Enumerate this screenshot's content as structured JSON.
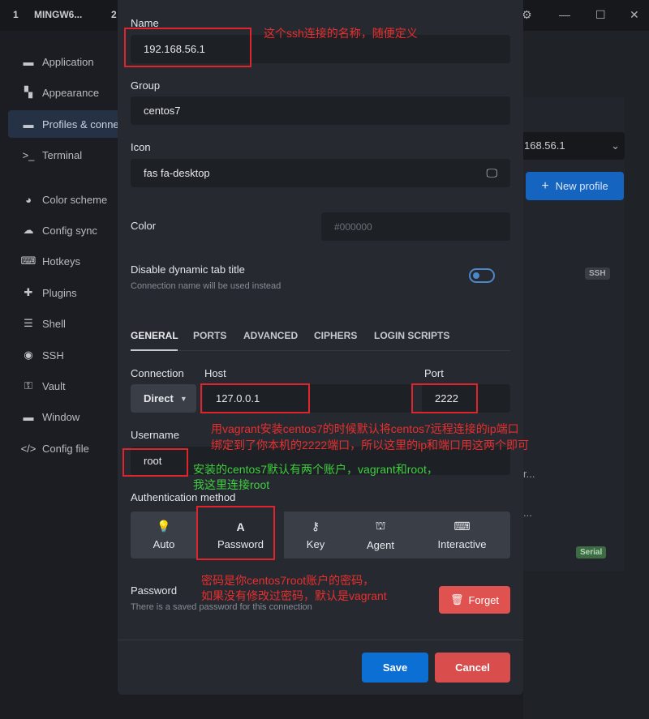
{
  "window": {
    "tab_number": "1",
    "tab_title": "MINGW6...",
    "tab2_number": "2",
    "icons": [
      "gear-icon",
      "minimize-icon",
      "maximize-icon",
      "close-icon"
    ]
  },
  "sidebar": {
    "items": [
      {
        "label": "Application",
        "icon": "window-icon"
      },
      {
        "label": "Appearance",
        "icon": "paint-icon"
      },
      {
        "label": "Profiles & conne",
        "icon": "window-icon",
        "active": true
      },
      {
        "label": "Terminal",
        "icon": "terminal-icon"
      },
      {
        "label": "Color scheme",
        "icon": "palette-icon"
      },
      {
        "label": "Config sync",
        "icon": "cloud-icon"
      },
      {
        "label": "Hotkeys",
        "icon": "keyboard-icon"
      },
      {
        "label": "Plugins",
        "icon": "puzzle-icon"
      },
      {
        "label": "Shell",
        "icon": "list-icon"
      },
      {
        "label": "SSH",
        "icon": "globe-icon"
      },
      {
        "label": "Vault",
        "icon": "key-icon"
      },
      {
        "label": "Window",
        "icon": "window-icon"
      },
      {
        "label": "Config file",
        "icon": "code-icon"
      }
    ]
  },
  "background": {
    "select_value": "168.56.1",
    "new_profile_label": "New profile",
    "ssh_badge": "SSH",
    "serial_badge": "Serial",
    "ellipsis_1": "r...",
    "ellipsis_2": "..."
  },
  "form": {
    "name_label": "Name",
    "name_value": "192.168.56.1",
    "group_label": "Group",
    "group_value": "centos7",
    "icon_label": "Icon",
    "icon_value": "fas fa-desktop",
    "color_label": "Color",
    "color_placeholder": "#000000",
    "dynamic_title_label": "Disable dynamic tab title",
    "dynamic_title_sub": "Connection name will be used instead",
    "tabs": [
      "GENERAL",
      "PORTS",
      "ADVANCED",
      "CIPHERS",
      "LOGIN SCRIPTS"
    ],
    "connection_label": "Connection",
    "connection_value": "Direct",
    "host_label": "Host",
    "host_value": "127.0.0.1",
    "port_label": "Port",
    "port_value": "2222",
    "username_label": "Username",
    "username_value": "root",
    "auth_label": "Authentication method",
    "auth_methods": [
      {
        "label": "Auto",
        "icon": "lightbulb-icon"
      },
      {
        "label": "Password",
        "icon": "font-icon"
      },
      {
        "label": "Key",
        "icon": "key-icon"
      },
      {
        "label": "Agent",
        "icon": "agent-icon"
      },
      {
        "label": "Interactive",
        "icon": "keyboard-icon"
      }
    ],
    "password_label": "Password",
    "password_sub": "There is a saved password for this connection",
    "forget_label": "Forget",
    "save_label": "Save",
    "cancel_label": "Cancel"
  },
  "annotations": {
    "name_note": "这个ssh连接的名称，随便定义",
    "host_note_1": "用vagrant安装centos7的时候默认将centos7远程连接的ip端口",
    "host_note_2": "绑定到了你本机的2222端口，所以这里的ip和端口用这两个即可",
    "user_note_1": "安装的centos7默认有两个账户，vagrant和root，",
    "user_note_2": "我这里连接root",
    "pwd_note_1": "密码是你centos7root账户的密码，",
    "pwd_note_2": "如果没有修改过密码，默认是vagrant"
  },
  "colors": {
    "accent": "#1565c0",
    "save": "#0c6fd4",
    "cancel": "#d94d4d",
    "forget": "#e0524f",
    "annotation_red": "#e0242c",
    "annotation_green": "#3fcf3f"
  }
}
